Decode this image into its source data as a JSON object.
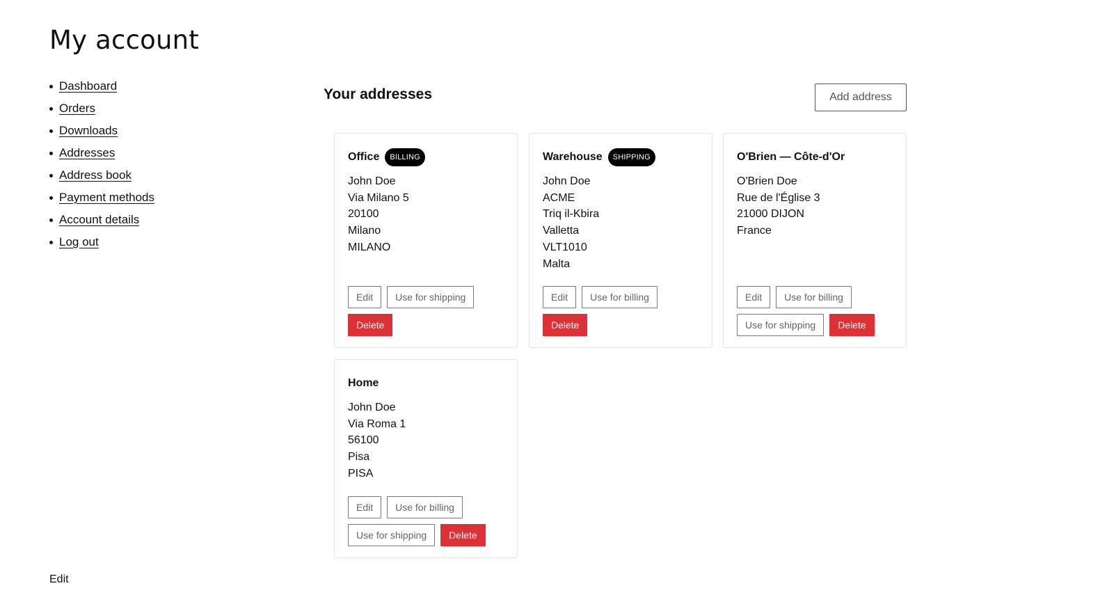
{
  "page_title": "My account",
  "nav": [
    {
      "label": "Dashboard"
    },
    {
      "label": "Orders"
    },
    {
      "label": "Downloads"
    },
    {
      "label": "Addresses"
    },
    {
      "label": "Address book"
    },
    {
      "label": "Payment methods"
    },
    {
      "label": "Account details"
    },
    {
      "label": "Log out"
    }
  ],
  "addresses": {
    "title": "Your addresses",
    "add_button": "Add address",
    "cards": [
      {
        "name": "Office",
        "badge": "BILLING",
        "lines": [
          "John Doe",
          "Via Milano 5",
          "20100",
          "Milano",
          "MILANO"
        ],
        "edit": "Edit",
        "use_shipping": "Use for shipping",
        "delete": "Delete"
      },
      {
        "name": "Warehouse",
        "badge": "SHIPPING",
        "lines": [
          "John Doe",
          "ACME",
          "Triq il-Kbira",
          "Valletta",
          "VLT1010",
          "Malta"
        ],
        "edit": "Edit",
        "use_billing": "Use for billing",
        "delete": "Delete"
      },
      {
        "name": "O'Brien — Côte-d'Or",
        "lines": [
          "O'Brien Doe",
          "Rue de l'Église 3",
          "21000 DIJON",
          "France"
        ],
        "edit": "Edit",
        "use_billing": "Use for billing",
        "use_shipping": "Use for shipping",
        "delete": "Delete"
      },
      {
        "name": "Home",
        "lines": [
          "John Doe",
          "Via Roma 1",
          "56100",
          "Pisa",
          "PISA"
        ],
        "edit": "Edit",
        "use_billing": "Use for billing",
        "use_shipping": "Use for shipping",
        "delete": "Delete"
      }
    ]
  },
  "footer": {
    "edit_label": "Edit"
  }
}
